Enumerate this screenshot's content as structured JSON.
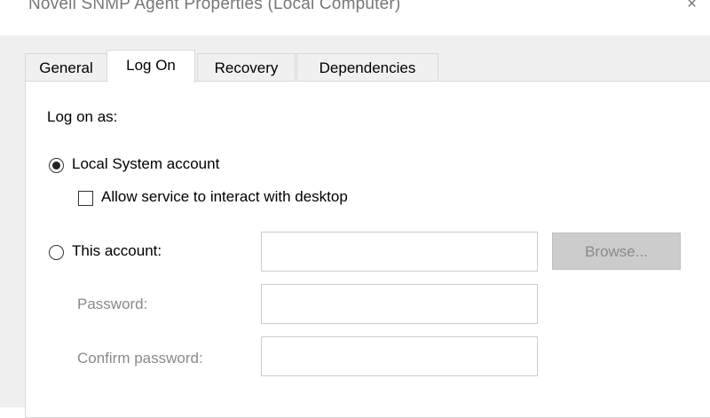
{
  "window": {
    "title": "Novell SNMP Agent Properties (Local Computer)",
    "close_glyph": "×"
  },
  "tabs": [
    {
      "label": "General",
      "selected": false
    },
    {
      "label": "Log On",
      "selected": true
    },
    {
      "label": "Recovery",
      "selected": false
    },
    {
      "label": "Dependencies",
      "selected": false
    }
  ],
  "logon": {
    "heading": "Log on as:",
    "local_system": {
      "label": "Local System account",
      "checked": true
    },
    "interact_desktop": {
      "label": "Allow service to interact with desktop",
      "checked": false
    },
    "this_account": {
      "label": "This account:",
      "checked": false,
      "value": ""
    },
    "browse_label": "Browse...",
    "password": {
      "label": "Password:",
      "value": ""
    },
    "confirm_password": {
      "label": "Confirm password:",
      "value": ""
    }
  }
}
